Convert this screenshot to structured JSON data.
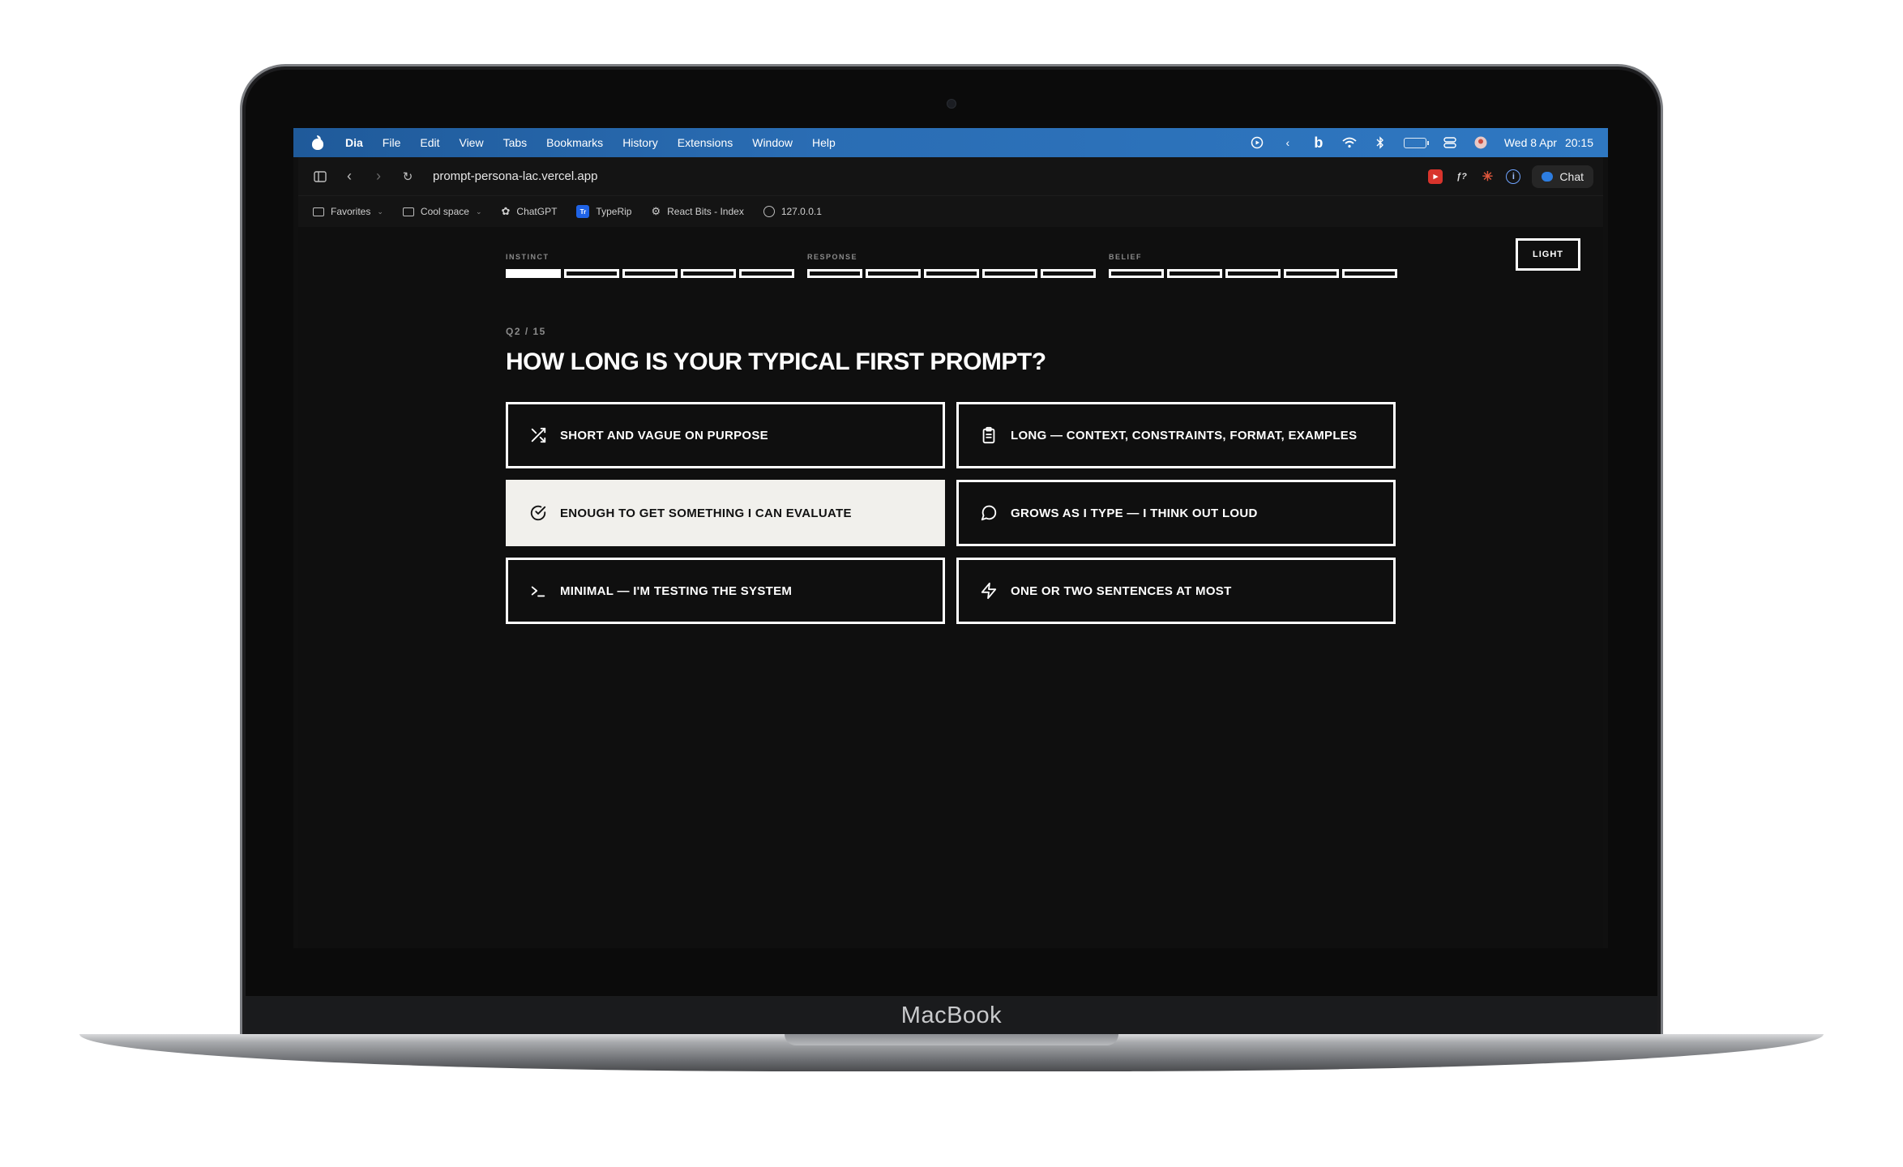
{
  "menubar": {
    "app_name": "Dia",
    "items": [
      "File",
      "Edit",
      "View",
      "Tabs",
      "Bookmarks",
      "History",
      "Extensions",
      "Window",
      "Help"
    ],
    "date": "Wed 8 Apr",
    "time": "20:15"
  },
  "browser": {
    "url": "prompt-persona-lac.vercel.app",
    "chat_label": "Chat",
    "bookmarks": [
      {
        "label": "Favorites",
        "type": "folder"
      },
      {
        "label": "Cool space",
        "type": "folder"
      },
      {
        "label": "ChatGPT",
        "type": "site"
      },
      {
        "label": "TypeRip",
        "type": "site"
      },
      {
        "label": "React Bits - Index",
        "type": "site"
      },
      {
        "label": "127.0.0.1",
        "type": "site"
      }
    ]
  },
  "page": {
    "theme_toggle": "LIGHT",
    "progress": {
      "sections": [
        {
          "label": "INSTINCT",
          "segments": 5,
          "filled": 1
        },
        {
          "label": "RESPONSE",
          "segments": 5,
          "filled": 0
        },
        {
          "label": "BELIEF",
          "segments": 5,
          "filled": 0
        }
      ]
    },
    "question_number": "Q2 / 15",
    "question": "HOW LONG IS YOUR TYPICAL FIRST PROMPT?",
    "options": [
      {
        "label": "SHORT AND VAGUE ON PURPOSE",
        "icon": "shuffle-icon",
        "selected": false
      },
      {
        "label": "LONG — CONTEXT, CONSTRAINTS, FORMAT, EXAMPLES",
        "icon": "clipboard-icon",
        "selected": false
      },
      {
        "label": "ENOUGH TO GET SOMETHING I CAN EVALUATE",
        "icon": "check-circle-icon",
        "selected": true
      },
      {
        "label": "GROWS AS I TYPE — I THINK OUT LOUD",
        "icon": "message-circle-icon",
        "selected": false
      },
      {
        "label": "MINIMAL — I'M TESTING THE SYSTEM",
        "icon": "terminal-icon",
        "selected": false
      },
      {
        "label": "ONE OR TWO SENTENCES AT MOST",
        "icon": "lightning-icon",
        "selected": false
      }
    ]
  },
  "device": {
    "brand": "MacBook"
  },
  "colors": {
    "menubar": "#2a6db4",
    "page_bg": "#0f0f0f",
    "selected_bg": "#f1f0ec",
    "accent": "#ffffff"
  }
}
